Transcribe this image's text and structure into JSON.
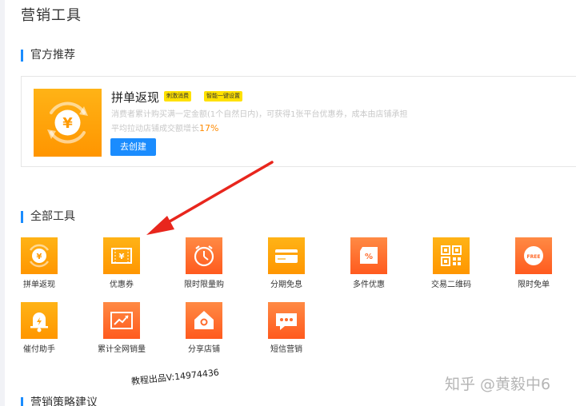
{
  "page": {
    "title": "营销工具"
  },
  "sections": {
    "recommend": "官方推荐",
    "all_tools": "全部工具",
    "strategy": "营销策略建议"
  },
  "recommend": {
    "name": "拼单返现",
    "tags": [
      "刺激消费",
      "智能一键设置"
    ],
    "desc_line1": "消费者累计购买满一定金额(1个自然日内)，可获得1张平台优惠券，成本由店铺承担",
    "desc_line2_prefix": "平均拉动店铺成交额增长",
    "desc_line2_value": "17%",
    "button": "去创建",
    "icon": "yuan-coin-icon"
  },
  "tools": [
    {
      "label": "拼单返现",
      "icon": "yuan-coin-icon"
    },
    {
      "label": "优惠券",
      "icon": "coupon-icon"
    },
    {
      "label": "限时限量购",
      "icon": "alarm-clock-icon"
    },
    {
      "label": "分期免息",
      "icon": "credit-card-icon"
    },
    {
      "label": "多件优惠",
      "icon": "discount-tag-icon"
    },
    {
      "label": "交易二维码",
      "icon": "qr-code-icon"
    },
    {
      "label": "限时免单",
      "icon": "free-badge-icon"
    },
    {
      "label": "催付助手",
      "icon": "bell-icon"
    },
    {
      "label": "累计全网销量",
      "icon": "trend-chart-icon"
    },
    {
      "label": "分享店铺",
      "icon": "share-store-icon"
    },
    {
      "label": "短信营销",
      "icon": "chat-bubble-icon"
    }
  ],
  "watermarks": {
    "code": "教程出品V:14974436",
    "zhihu": "知乎 @黄毅中6"
  },
  "colors": {
    "accent_blue": "#1a8cfe",
    "icon_yellow": "#ffa30a",
    "icon_orange": "#ff6a2a",
    "tag_yellow": "#ffe100",
    "highlight_orange": "#ff8a00",
    "annotation_red": "#e8261d"
  }
}
